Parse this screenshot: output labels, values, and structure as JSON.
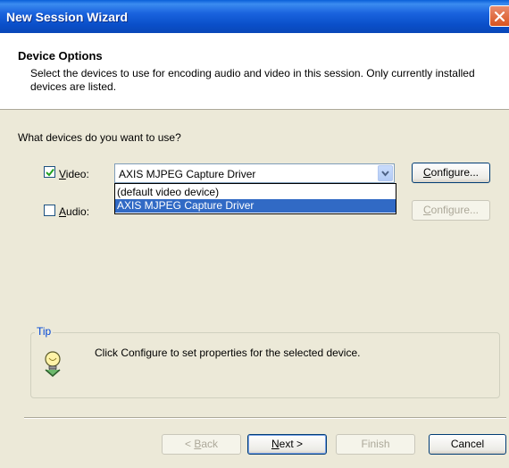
{
  "window": {
    "title": "New Session Wizard"
  },
  "header": {
    "title": "Device Options",
    "description": "Select the devices to use for encoding audio and video in this session. Only currently installed devices are listed."
  },
  "question": "What devices do you want to use?",
  "video": {
    "checked": true,
    "label_prefix": "V",
    "label_rest": "ideo:",
    "selected": "AXIS MJPEG Capture Driver",
    "options": [
      "(default video device)",
      "AXIS MJPEG Capture Driver"
    ],
    "configure_prefix": "C",
    "configure_rest": "onfigure..."
  },
  "audio": {
    "checked": false,
    "label_prefix": "A",
    "label_rest": "udio:",
    "configure_prefix": "C",
    "configure_rest": "onfigure..."
  },
  "tip": {
    "legend": "Tip",
    "text": "Click Configure to set properties for the selected device."
  },
  "footer": {
    "back_arrow": "< ",
    "back_prefix": "B",
    "back_rest": "ack",
    "next_prefix": "N",
    "next_rest": "ext >",
    "finish": "Finish",
    "cancel": "Cancel"
  },
  "icons": {
    "close": "close-icon",
    "check": "checkmark-icon",
    "dropdown": "chevron-down-icon",
    "tip": "lightbulb-icon"
  }
}
